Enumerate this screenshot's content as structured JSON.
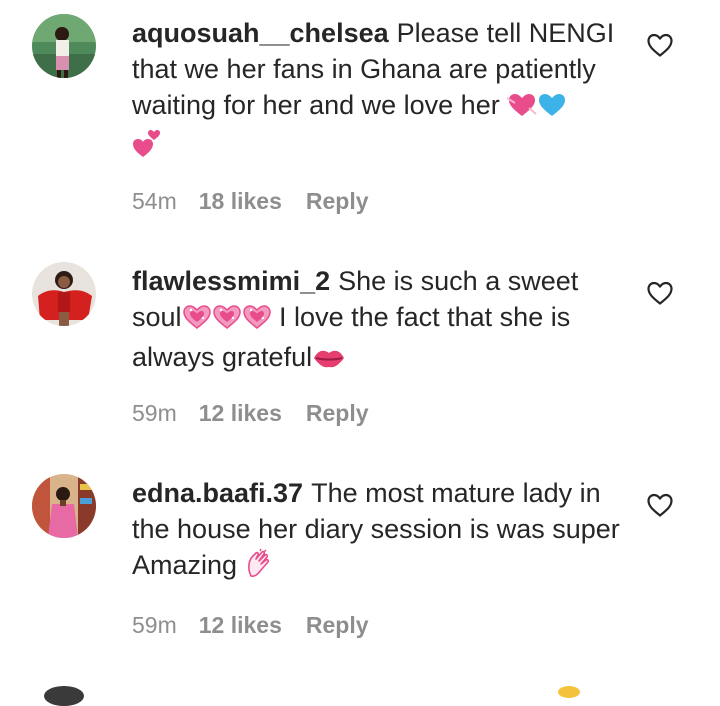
{
  "comments": [
    {
      "username": "aquosuah__chelsea",
      "text": "Please tell NENGI that we her fans in Ghana are patiently waiting for her and we love her",
      "emojis": [
        "heart-with-arrow",
        "blue-heart",
        "two-hearts"
      ],
      "time": "54m",
      "likes": "18 likes",
      "reply_label": "Reply"
    },
    {
      "username": "flawlessmimi_2",
      "text_before": "She is such a sweet soul",
      "text_after": "I love the fact that she is always grateful",
      "emojis": [
        "sparkling-heart",
        "sparkling-heart",
        "sparkling-heart",
        "kiss-mark"
      ],
      "time": "59m",
      "likes": "12 likes",
      "reply_label": "Reply"
    },
    {
      "username": "edna.baafi.37",
      "text": "The most mature lady in the house her diary session is was super Amazing",
      "emojis": [
        "clapping-hands"
      ],
      "time": "59m",
      "likes": "12 likes",
      "reply_label": "Reply"
    }
  ],
  "colors": {
    "text": "#262626",
    "meta": "#8e8e8e",
    "heart_pink": "#e84c8b",
    "heart_blue": "#3bb2e8"
  }
}
